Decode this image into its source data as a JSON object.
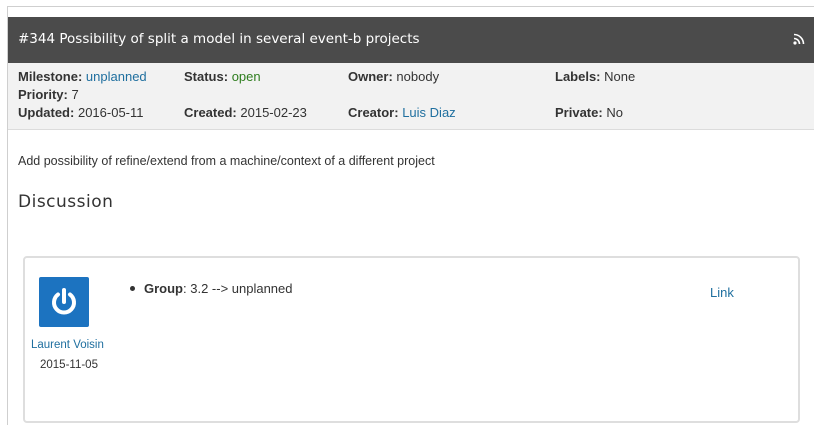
{
  "ticket": {
    "title": "#344 Possibility of split a model in several event-b projects",
    "rss_icon": "rss-icon"
  },
  "meta": {
    "milestone_label": "Milestone:",
    "milestone_value": "unplanned",
    "status_label": "Status:",
    "status_value": "open",
    "owner_label": "Owner:",
    "owner_value": "nobody",
    "labels_label": "Labels:",
    "labels_value": "None",
    "priority_label": "Priority:",
    "priority_value": "7",
    "updated_label": "Updated:",
    "updated_value": "2016-05-11",
    "created_label": "Created:",
    "created_value": "2015-02-23",
    "creator_label": "Creator:",
    "creator_value": "Luis Diaz",
    "private_label": "Private:",
    "private_value": "No"
  },
  "description": "Add possibility of refine/extend from a machine/context of a different project",
  "discussion": {
    "heading": "Discussion",
    "comments": [
      {
        "author": "Laurent Voisin",
        "date": "2015-11-05",
        "change_field": "Group",
        "change_value": ": 3.2 --> unplanned",
        "link_label": "Link",
        "avatar_icon": "power-icon"
      }
    ]
  },
  "colors": {
    "title_bar": "#4b4b4b",
    "meta_bg": "#f2f2f2",
    "link": "#1f6f9f",
    "status_open": "#2e7d1e",
    "avatar_bg": "#1c73c0"
  }
}
